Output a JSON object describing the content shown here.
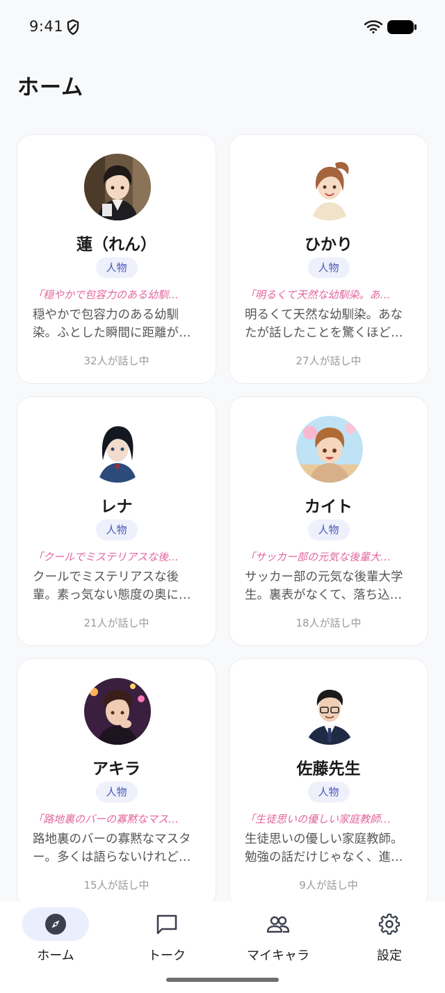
{
  "status": {
    "time": "9:41"
  },
  "header": {
    "title": "ホーム"
  },
  "cards": [
    {
      "name": "蓮（れん）",
      "tag": "人物",
      "quote": "「穏やかで包容力のある幼馴…",
      "desc": "穏やかで包容力のある幼馴染。ふとした瞬間に距離が…",
      "count": "32人が話し中",
      "avatar": "avatar-ren"
    },
    {
      "name": "ひかり",
      "tag": "人物",
      "quote": "「明るくて天然な幼馴染。あ…",
      "desc": "明るくて天然な幼馴染。あなたが話したことを驚くほど…",
      "count": "27人が話し中",
      "avatar": "avatar-hikari"
    },
    {
      "name": "レナ",
      "tag": "人物",
      "quote": "「クールでミステリアスな後…",
      "desc": "クールでミステリアスな後輩。素っ気ない態度の奥に…",
      "count": "21人が話し中",
      "avatar": "avatar-rena"
    },
    {
      "name": "カイト",
      "tag": "人物",
      "quote": "「サッカー部の元気な後輩大…",
      "desc": "サッカー部の元気な後輩大学生。裏表がなくて、落ち込…",
      "count": "18人が話し中",
      "avatar": "avatar-kaito"
    },
    {
      "name": "アキラ",
      "tag": "人物",
      "quote": "「路地裏のバーの寡黙なマス…",
      "desc": "路地裏のバーの寡黙なマスター。多くは語らないけれど…",
      "count": "15人が話し中",
      "avatar": "avatar-akira"
    },
    {
      "name": "佐藤先生",
      "tag": "人物",
      "quote": "「生徒思いの優しい家庭教師…",
      "desc": "生徒思いの優しい家庭教師。勉強の話だけじゃなく、進…",
      "count": "9人が話し中",
      "avatar": "avatar-sato"
    }
  ],
  "nav": {
    "home": "ホーム",
    "talk": "トーク",
    "mychara": "マイキャラ",
    "settings": "設定"
  }
}
